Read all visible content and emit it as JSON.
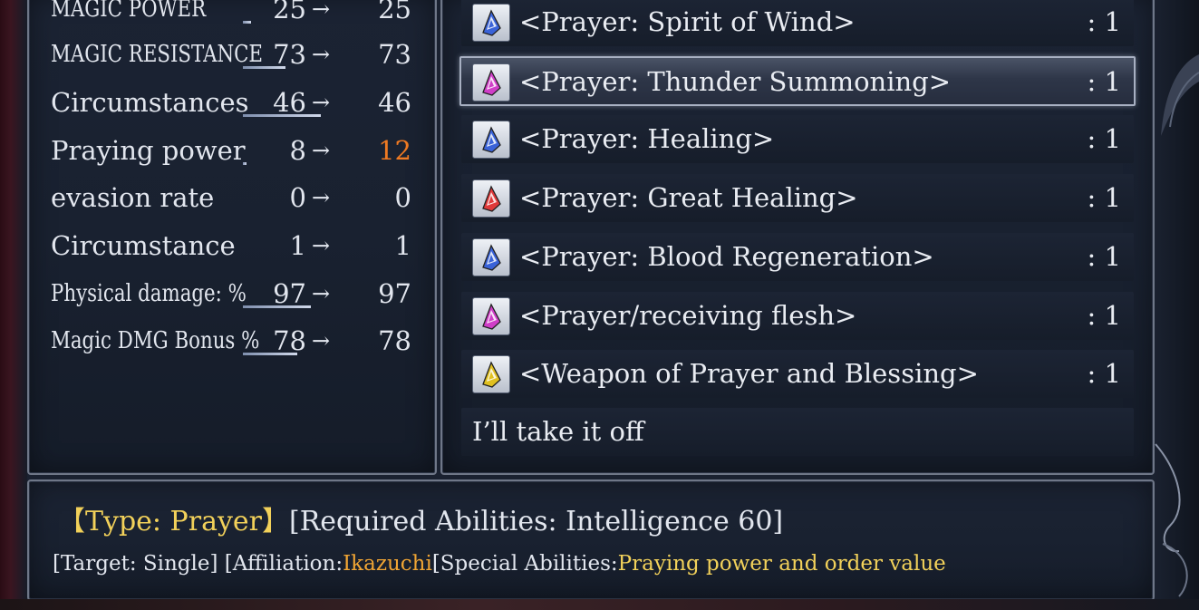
{
  "stats": [
    {
      "label": "MAGIC POWER",
      "before": "25",
      "after": "25",
      "narrow": true,
      "bar": 0.1,
      "changed": false
    },
    {
      "label": "MAGIC RESISTANCE",
      "before": "73",
      "after": "73",
      "narrow": true,
      "bar": 0.55,
      "changed": false
    },
    {
      "label": "Circumstances",
      "before": "46",
      "after": "46",
      "narrow": false,
      "bar": 1.0,
      "changed": false
    },
    {
      "label": "Praying power",
      "before": "8",
      "after": "12",
      "narrow": false,
      "bar": 0.05,
      "changed": true
    },
    {
      "label": "evasion rate",
      "before": "0",
      "after": "0",
      "narrow": false,
      "bar": 0,
      "changed": false
    },
    {
      "label": "Circumstance",
      "before": "1",
      "after": "1",
      "narrow": false,
      "bar": 0,
      "changed": false
    },
    {
      "label": "Physical damage: %",
      "before": "97",
      "after": "97",
      "narrow": true,
      "bar": 0.87,
      "changed": false
    },
    {
      "label": "Magic DMG Bonus %",
      "before": "78",
      "after": "78",
      "narrow": true,
      "bar": 0.7,
      "changed": false
    }
  ],
  "arrow": "→",
  "items": [
    {
      "name": "<Prayer: Spirit of Wind>",
      "count": ": 1",
      "icon": "blue-prayer-book-icon",
      "color": "#3a63d8",
      "selected": false
    },
    {
      "name": "<Prayer: Thunder Summoning>",
      "count": ": 1",
      "icon": "pink-prayer-book-icon",
      "color": "#d03ec8",
      "selected": true
    },
    {
      "name": "<Prayer: Healing>",
      "count": ": 1",
      "icon": "blue-prayer-book-icon",
      "color": "#3a63d8",
      "selected": false
    },
    {
      "name": "<Prayer: Great Healing>",
      "count": ": 1",
      "icon": "red-prayer-book-icon",
      "color": "#e03a3a",
      "selected": false
    },
    {
      "name": "<Prayer: Blood Regeneration>",
      "count": ": 1",
      "icon": "blue-prayer-book-icon",
      "color": "#3a63d8",
      "selected": false
    },
    {
      "name": "<Prayer/receiving flesh>",
      "count": ": 1",
      "icon": "pink-prayer-book-icon",
      "color": "#d03ec8",
      "selected": false
    },
    {
      "name": "<Weapon of Prayer and Blessing>",
      "count": ": 1",
      "icon": "yellow-prayer-book-icon",
      "color": "#e0c020",
      "selected": false
    },
    {
      "name": "I’ll take it off",
      "count": "",
      "icon": "",
      "color": "",
      "selected": false
    }
  ],
  "description": {
    "type_label": "【Type: Prayer】",
    "requirements": "[Required Abilities: Intelligence 60]",
    "target": "[Target: Single] [Affiliation:",
    "affiliation": "Ikazuchi",
    "special_prefix": "[Special Abilities:",
    "special": "Praying power and order value"
  }
}
